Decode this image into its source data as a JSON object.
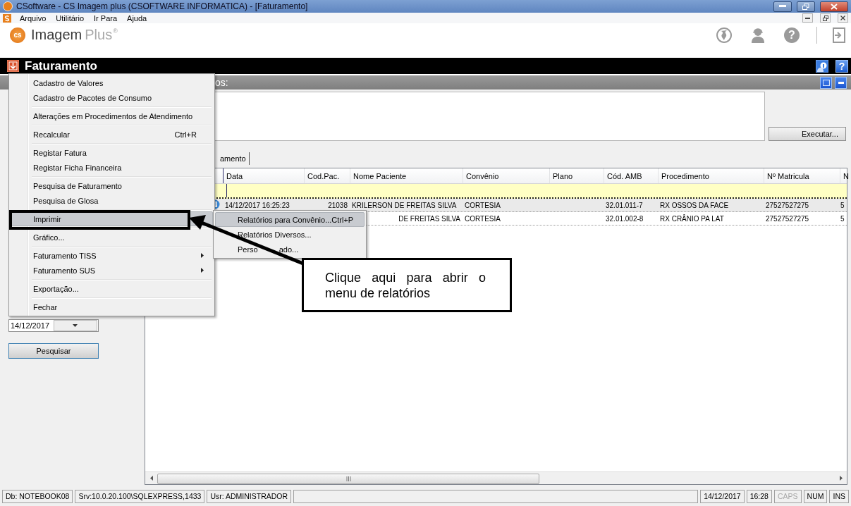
{
  "window": {
    "title": "CSoftware - CS Imagem plus (CSOFTWARE INFORMATICA) - [Faturamento]"
  },
  "menubar": [
    {
      "label": "Arquivo"
    },
    {
      "label": "Utilitário"
    },
    {
      "label": "Ir Para"
    },
    {
      "label": "Ajuda"
    }
  ],
  "logo": {
    "badge": "cs",
    "name": "Imagem",
    "suffix": "Plus",
    "mark": "®"
  },
  "toolbar": {
    "help_glyph": "?"
  },
  "module": {
    "title": "Faturamento",
    "help_glyph": "?"
  },
  "panel": {
    "title": "os:",
    "action": "Executar..."
  },
  "tabs": [
    {
      "label": "amento",
      "selected": true
    }
  ],
  "grid": {
    "columns": [
      "Data",
      "Cod.Pac.",
      "Nome Paciente",
      "Convênio",
      "Plano",
      "Cód. AMB",
      "Procedimento",
      "Nº Matricula",
      "N"
    ],
    "rows": [
      {
        "kind": "full",
        "selected": true,
        "cells": [
          "14/12/2017 16:25:23",
          "21038",
          "KRILERSON DE FREITAS SILVA",
          "CORTESIA",
          null,
          "32.01.011-7",
          "RX OSSOS DA FACE",
          "27527527275",
          "5"
        ]
      },
      {
        "kind": "covered",
        "selected": false,
        "cells": [
          null,
          null,
          "DE FREITAS SILVA",
          "CORTESIA",
          null,
          "32.01.002-8",
          "RX CRÂNIO PA LAT",
          "27527527275",
          "5"
        ]
      }
    ]
  },
  "filter": {
    "date": "14/12/2017",
    "button": "Pesquisar"
  },
  "menu": {
    "items": [
      {
        "kind": "item",
        "label": "Cadastro de Valores",
        "submenu": false,
        "selected": false
      },
      {
        "kind": "item",
        "label": "Cadastro de Pacotes de Consumo",
        "submenu": false,
        "selected": false
      },
      {
        "kind": "separator"
      },
      {
        "kind": "item",
        "label": "Alterações em Procedimentos de Atendimento",
        "submenu": false,
        "selected": false
      },
      {
        "kind": "separator"
      },
      {
        "kind": "item",
        "label": "Recalcular",
        "shortcut": "Ctrl+R",
        "submenu": false,
        "selected": false
      },
      {
        "kind": "separator"
      },
      {
        "kind": "item",
        "label": "Registar Fatura",
        "submenu": false,
        "selected": false
      },
      {
        "kind": "item",
        "label": "Registar Ficha Financeira",
        "submenu": false,
        "selected": false
      },
      {
        "kind": "separator"
      },
      {
        "kind": "item",
        "label": "Pesquisa de Faturamento",
        "submenu": false,
        "selected": false
      },
      {
        "kind": "item",
        "label": "Pesquisa de Glosa",
        "submenu": false,
        "selected": false
      },
      {
        "kind": "separator"
      },
      {
        "kind": "item",
        "label": "Imprimir",
        "submenu": true,
        "selected": true
      },
      {
        "kind": "separator"
      },
      {
        "kind": "item",
        "label": "Gráfico...",
        "submenu": false,
        "selected": false
      },
      {
        "kind": "separator"
      },
      {
        "kind": "item",
        "label": "Faturamento TISS",
        "submenu": true,
        "selected": false
      },
      {
        "kind": "item",
        "label": "Faturamento SUS",
        "submenu": true,
        "selected": false
      },
      {
        "kind": "separator"
      },
      {
        "kind": "item",
        "label": "Exportação...",
        "submenu": false,
        "selected": false
      },
      {
        "kind": "separator"
      },
      {
        "kind": "item",
        "label": "Fechar",
        "submenu": false,
        "selected": false
      }
    ]
  },
  "submenu": {
    "items": [
      {
        "label": "Relatórios para Convênio...",
        "shortcut": "Ctrl+P",
        "selected": true
      },
      {
        "label": "Relatórios Diversos...",
        "selected": false
      },
      {
        "label": "Perso",
        "label_tail": "ado...",
        "selected": false
      }
    ]
  },
  "callout": {
    "text": "Clique aqui para abrir o menu de relatórios"
  },
  "status_bar": [
    {
      "text": "Db: NOTEBOOK08",
      "on": true
    },
    {
      "text": "Srv:10.0.20.100\\SQLEXPRESS,1433",
      "on": true
    },
    {
      "text": "Usr: ADMINISTRADOR",
      "on": true
    },
    {
      "text": "14/12/2017",
      "on": true
    },
    {
      "text": "16:28",
      "on": true
    },
    {
      "text": "CAPS",
      "on": false
    },
    {
      "text": "NUM",
      "on": true
    },
    {
      "text": "INS",
      "on": true
    }
  ]
}
